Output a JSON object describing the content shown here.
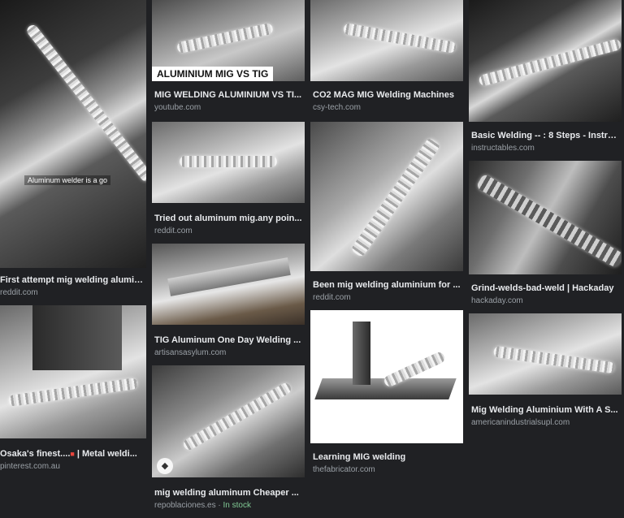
{
  "results": [
    {
      "title": "First attempt mig welding alumin...",
      "source": "reddit.com",
      "overlay": "Aluminum welder is a go"
    },
    {
      "title": "Osaka's finest....",
      "title_suffix": " | Metal weldi...",
      "source": "pinterest.com.au",
      "flag_icon": "flag-icon"
    },
    {
      "title": "MIG WELDING ALUMINIUM VS TI...",
      "source": "youtube.com",
      "overlay": "ALUMINIUM MIG VS TIG"
    },
    {
      "title": "Tried out aluminum mig.any poin...",
      "source": "reddit.com"
    },
    {
      "title": "TIG Aluminum One Day Welding ...",
      "source": "artisansasylum.com"
    },
    {
      "title": "mig welding aluminum Cheaper ...",
      "source": "repoblaciones.es",
      "separator": " · ",
      "stock": "In stock",
      "tag_icon": "tag-icon"
    },
    {
      "title": "CO2 MAG MIG Welding Machines",
      "source": "csy-tech.com"
    },
    {
      "title": "Been mig welding aluminium for ...",
      "source": "reddit.com"
    },
    {
      "title": "Learning MIG welding",
      "source": "thefabricator.com"
    },
    {
      "title": "Basic Welding -- : 8 Steps - Instru...",
      "source": "instructables.com"
    },
    {
      "title": "Grind-welds-bad-weld | Hackaday",
      "source": "hackaday.com"
    },
    {
      "title": "Mig Welding Aluminium With A S...",
      "source": "americanindustrialsupl.com"
    }
  ],
  "colors": {
    "background": "#202124",
    "title": "#e8eaed",
    "source": "#9aa0a6",
    "stock": "#81c995"
  }
}
